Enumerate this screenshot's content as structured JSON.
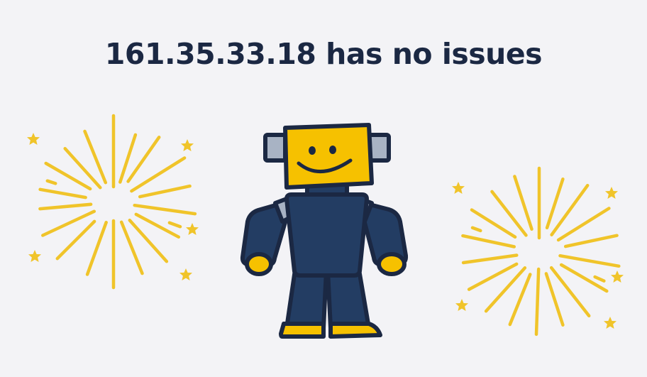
{
  "result": {
    "title": "161.35.33.18 has no issues"
  },
  "illustration": {
    "icons": [
      "robot-mascot-icon",
      "firework-burst-icon",
      "star-icon"
    ],
    "colors": {
      "background": "#f3f3f6",
      "navy": "#1b2843",
      "robot_body": "#233d63",
      "robot_face": "#f6c100",
      "firework": "#f0c42a",
      "metal": "#a8b3c4"
    }
  }
}
